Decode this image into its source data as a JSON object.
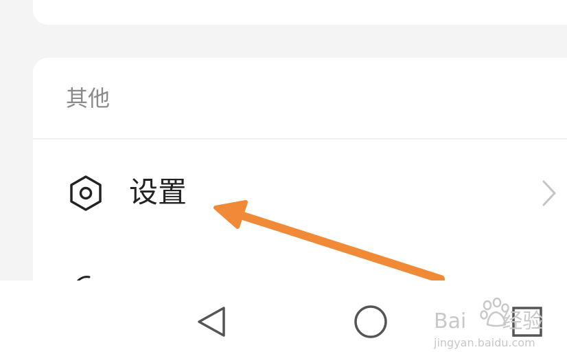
{
  "section": {
    "title": "其他"
  },
  "settings_item": {
    "label": "设置",
    "icon": "settings-hexagon-icon",
    "trailing_icon": "chevron-right-icon"
  },
  "navigation_bar": {
    "buttons": [
      {
        "icon": "back-triangle-icon"
      },
      {
        "icon": "home-circle-icon"
      },
      {
        "icon": "recent-apps-square-icon"
      }
    ]
  },
  "annotation": {
    "icon": "pointer-arrow-icon",
    "color": "#f08a36"
  },
  "watermark": {
    "brand_text": "Bai",
    "brand_text_tail": "经验",
    "url_text": "jingyan.baidu.com"
  },
  "colors": {
    "background": "#f4f4f4",
    "card": "#ffffff",
    "section_title": "#8a8a8a",
    "label": "#222222",
    "chevron": "#c4c4c4",
    "nav_icon": "#555555"
  }
}
